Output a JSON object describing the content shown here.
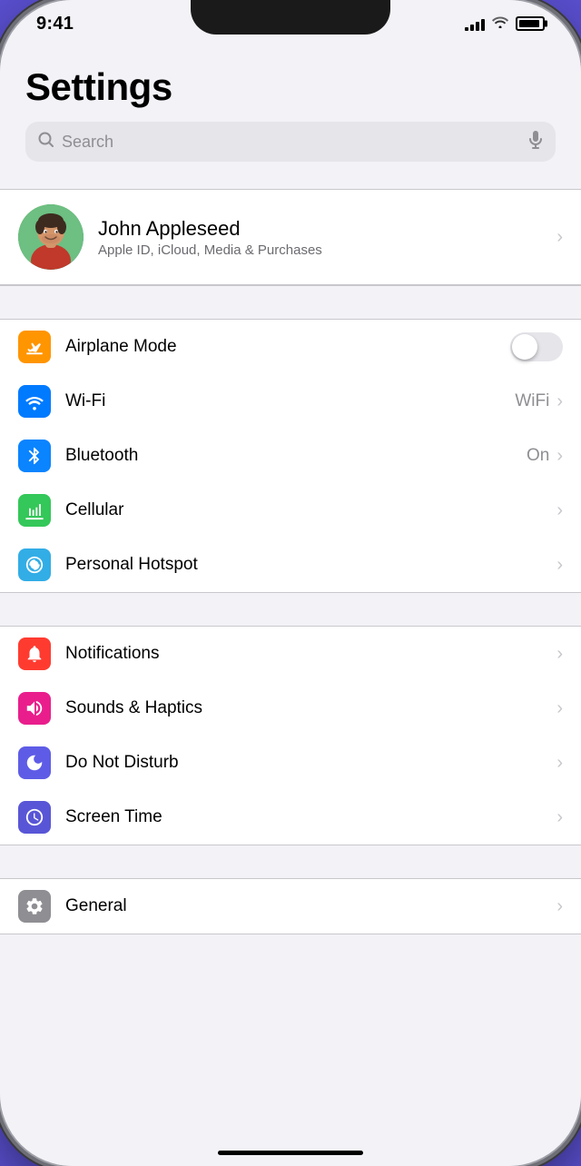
{
  "status": {
    "time": "9:41",
    "signal_bars": [
      4,
      6,
      9,
      12,
      15
    ],
    "wifi": "wifi",
    "battery": 90
  },
  "page": {
    "title": "Settings"
  },
  "search": {
    "placeholder": "Search"
  },
  "profile": {
    "name": "John Appleseed",
    "subtitle": "Apple ID, iCloud, Media & Purchases"
  },
  "sections": {
    "connectivity": [
      {
        "id": "airplane-mode",
        "label": "Airplane Mode",
        "icon_color": "icon-orange",
        "icon_symbol": "✈",
        "type": "toggle",
        "value": false
      },
      {
        "id": "wifi",
        "label": "Wi-Fi",
        "icon_color": "icon-blue",
        "icon_symbol": "wifi",
        "type": "value",
        "value": "WiFi"
      },
      {
        "id": "bluetooth",
        "label": "Bluetooth",
        "icon_color": "icon-blue-dark",
        "icon_symbol": "bluetooth",
        "type": "value",
        "value": "On"
      },
      {
        "id": "cellular",
        "label": "Cellular",
        "icon_color": "icon-cellular",
        "icon_symbol": "cellular",
        "type": "chevron"
      },
      {
        "id": "hotspot",
        "label": "Personal Hotspot",
        "icon_color": "icon-green",
        "icon_symbol": "hotspot",
        "type": "chevron"
      }
    ],
    "notifications": [
      {
        "id": "notifications",
        "label": "Notifications",
        "icon_color": "icon-red",
        "icon_symbol": "notifications",
        "type": "chevron"
      },
      {
        "id": "sounds",
        "label": "Sounds & Haptics",
        "icon_color": "icon-pink",
        "icon_symbol": "sounds",
        "type": "chevron"
      },
      {
        "id": "dnd",
        "label": "Do Not Disturb",
        "icon_color": "icon-indigo",
        "icon_symbol": "dnd",
        "type": "chevron"
      },
      {
        "id": "screentime",
        "label": "Screen Time",
        "icon_color": "icon-purple",
        "icon_symbol": "screentime",
        "type": "chevron"
      }
    ],
    "general": [
      {
        "id": "general",
        "label": "General",
        "icon_color": "icon-gray",
        "icon_symbol": "general",
        "type": "chevron"
      }
    ]
  },
  "colors": {
    "background": "#f2f2f7",
    "card_bg": "#ffffff",
    "separator": "#c8c8cc",
    "label": "#000000",
    "secondary": "#8e8e93",
    "accent": "#007aff"
  }
}
